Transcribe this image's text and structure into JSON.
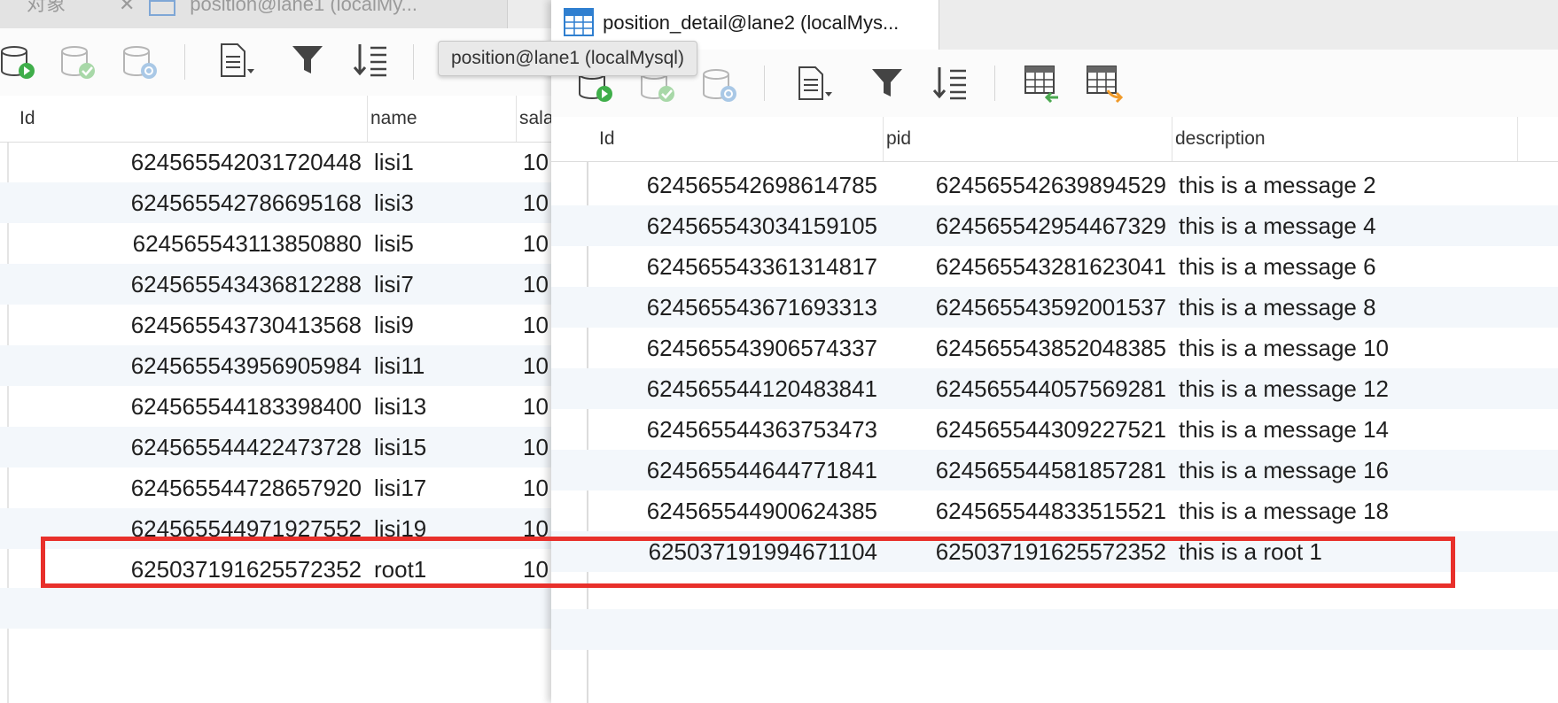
{
  "left_window": {
    "tabs": [
      {
        "label": "对象"
      },
      {
        "label": "position@lane1 (localMy..."
      }
    ],
    "toolbar_icons": [
      "db-run-icon",
      "db-commit-icon",
      "db-refresh-icon",
      "document-icon",
      "filter-icon",
      "sort-icon"
    ],
    "columns": [
      "Id",
      "name",
      "sala"
    ],
    "rows": [
      {
        "id": "624565542031720448",
        "name": "lisi1",
        "sala": "10"
      },
      {
        "id": "624565542786695168",
        "name": "lisi3",
        "sala": "10"
      },
      {
        "id": "624565543113850880",
        "name": "lisi5",
        "sala": "10"
      },
      {
        "id": "624565543436812288",
        "name": "lisi7",
        "sala": "10"
      },
      {
        "id": "624565543730413568",
        "name": "lisi9",
        "sala": "10"
      },
      {
        "id": "624565543956905984",
        "name": "lisi11",
        "sala": "10"
      },
      {
        "id": "624565544183398400",
        "name": "lisi13",
        "sala": "10"
      },
      {
        "id": "624565544422473728",
        "name": "lisi15",
        "sala": "10"
      },
      {
        "id": "624565544728657920",
        "name": "lisi17",
        "sala": "10"
      },
      {
        "id": "624565544971927552",
        "name": "lisi19",
        "sala": "10"
      },
      {
        "id": "625037191625572352",
        "name": "root1",
        "sala": "10"
      }
    ]
  },
  "tooltip": "position@lane1 (localMysql)",
  "right_window": {
    "tab_label": "position_detail@lane2 (localMys...",
    "toolbar_icons": [
      "db-run-icon",
      "db-commit-icon",
      "db-refresh-icon",
      "document-icon",
      "filter-icon",
      "sort-icon",
      "import-table-icon",
      "export-table-icon"
    ],
    "columns": [
      "Id",
      "pid",
      "description"
    ],
    "rows": [
      {
        "id": "624565542698614785",
        "pid": "624565542639894529",
        "description": "this is a message 2"
      },
      {
        "id": "624565543034159105",
        "pid": "624565542954467329",
        "description": "this is a message 4"
      },
      {
        "id": "624565543361314817",
        "pid": "624565543281623041",
        "description": "this is a message 6"
      },
      {
        "id": "624565543671693313",
        "pid": "624565543592001537",
        "description": "this is a message 8"
      },
      {
        "id": "624565543906574337",
        "pid": "624565543852048385",
        "description": "this is a message 10"
      },
      {
        "id": "624565544120483841",
        "pid": "624565544057569281",
        "description": "this is a message 12"
      },
      {
        "id": "624565544363753473",
        "pid": "624565544309227521",
        "description": "this is a message 14"
      },
      {
        "id": "624565544644771841",
        "pid": "624565544581857281",
        "description": "this is a message 16"
      },
      {
        "id": "624565544900624385",
        "pid": "624565544833515521",
        "description": "this is a message 18"
      },
      {
        "id": "625037191994671104",
        "pid": "625037191625572352",
        "description": "this is a root 1"
      }
    ]
  },
  "colors": {
    "highlight": "#e8302b",
    "row_alt": "#f3f7fb",
    "accent": "#2f7fd0"
  }
}
